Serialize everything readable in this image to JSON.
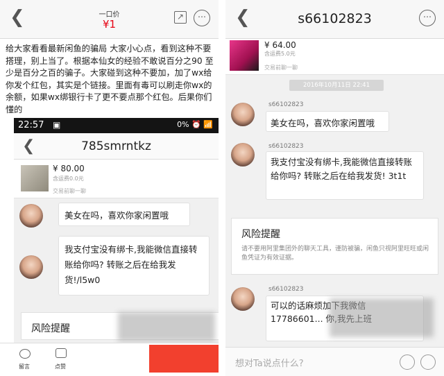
{
  "left": {
    "header": {
      "price_label": "一口价",
      "price_value": "¥1"
    },
    "post_text": "给大家看看最新闲鱼的骗局 大家小心点，看到这种不要搭理，别上当了。根据本仙女的经验不敢说百分之90 至少是百分之百的骗子。大家碰到这种不要加，加了wx给你发个红包，其实是个链接。里面有毒可以刷走你wx的余额，如果wx绑银行卡了更不要点那个红包。后果你们懂的",
    "status_bar": {
      "time": "22:57",
      "right": "0% ⏰ 📶"
    },
    "chat": {
      "title": "785smrntkz",
      "product": {
        "price": "¥ 80.00",
        "shipping": "含运费0.0元",
        "note": "交易前聊一聊"
      },
      "messages": [
        {
          "text": "美女在吗，喜欢你家闲置哦"
        },
        {
          "text": "我支付宝没有绑卡,我能微信直接转账给你吗? 转账之后在给我发货!/l5w0"
        }
      ],
      "risk_title": "风险提醒"
    },
    "bottom": {
      "comment_label": "留言",
      "like_label": "点赞"
    }
  },
  "right": {
    "header": {
      "title": "s66102823"
    },
    "product": {
      "price": "¥ 64.00",
      "shipping": "含运费5.0元",
      "note": "交易前聊一聊"
    },
    "timestamp": "2016年10月11日 22:41",
    "messages": [
      {
        "sender": "s66102823",
        "text": "美女在吗，喜欢你家闲置哦"
      },
      {
        "sender": "s66102823",
        "text": "我支付宝没有绑卡,我能微信直接转账给你吗? 转账之后在给我发货! 3t1t"
      },
      {
        "sender": "s66102823",
        "text": "可以的话麻烦加下我微信 17786601... 你,我先上班"
      }
    ],
    "risk": {
      "title": "风险提醒",
      "text": "请不要用阿里集团外的聊天工具，谨防被骗，闲鱼只视阿里旺旺或闲鱼凭证为有效证据。"
    },
    "input_placeholder": "想对Ta说点什么?"
  },
  "colors": {
    "accent_red": "#e60012",
    "button_red": "#f2402e"
  }
}
